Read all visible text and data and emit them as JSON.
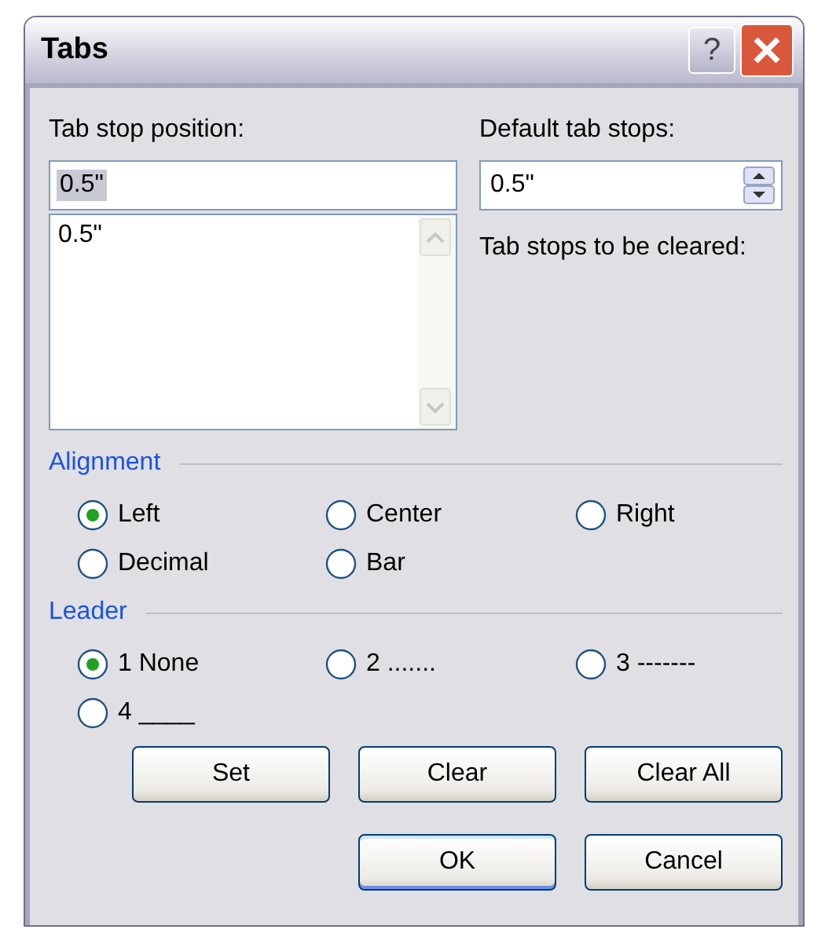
{
  "window": {
    "title": "Tabs",
    "help_button": "?"
  },
  "tab_stop_position": {
    "label": "Tab stop position:",
    "value": "0.5\"",
    "selected": true
  },
  "tab_stop_list": {
    "items": [
      "0.5\""
    ]
  },
  "default_tab_stops": {
    "label": "Default tab stops:",
    "value": "0.5\""
  },
  "tab_stops_to_be_cleared": {
    "label": "Tab stops to be cleared:"
  },
  "alignment": {
    "title": "Alignment",
    "options": [
      {
        "label": "Left",
        "selected": true
      },
      {
        "label": "Center",
        "selected": false
      },
      {
        "label": "Right",
        "selected": false
      },
      {
        "label": "Decimal",
        "selected": false
      },
      {
        "label": "Bar",
        "selected": false
      }
    ]
  },
  "leader": {
    "title": "Leader",
    "options": [
      {
        "label": "1 None",
        "selected": true
      },
      {
        "label": "2 .......",
        "selected": false
      },
      {
        "label": "3 -------",
        "selected": false
      },
      {
        "label": "4 ____",
        "selected": false
      }
    ]
  },
  "action_buttons": [
    {
      "label": "Set",
      "default": false
    },
    {
      "label": "Clear",
      "default": false
    },
    {
      "label": "Clear All",
      "default": false
    }
  ],
  "dialog_buttons": [
    {
      "label": "OK",
      "default": true
    },
    {
      "label": "Cancel",
      "default": false
    }
  ]
}
